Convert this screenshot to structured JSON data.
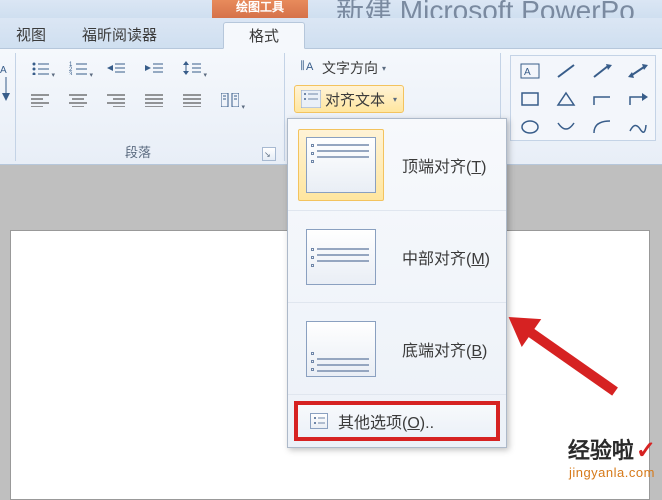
{
  "title": {
    "contextual_tab": "绘图工具",
    "app_prefix": "新建",
    "app_name": "Microsoft PowerPo"
  },
  "tabs": {
    "view": "视图",
    "foxit": "福昕阅读器",
    "format": "格式"
  },
  "ribbon": {
    "group_paragraph": "段落",
    "text_direction": "文字方向",
    "align_text": "对齐文本"
  },
  "dropdown": {
    "top": {
      "label": "顶端对齐",
      "key": "T"
    },
    "middle": {
      "label": "中部对齐",
      "key": "M"
    },
    "bottom": {
      "label": "底端对齐",
      "key": "B"
    },
    "more": {
      "label": "其他选项",
      "key": "O",
      "suffix": ".."
    }
  },
  "watermark": {
    "line1": "经验啦",
    "check": "✓",
    "line2": "jingyanla.com"
  }
}
